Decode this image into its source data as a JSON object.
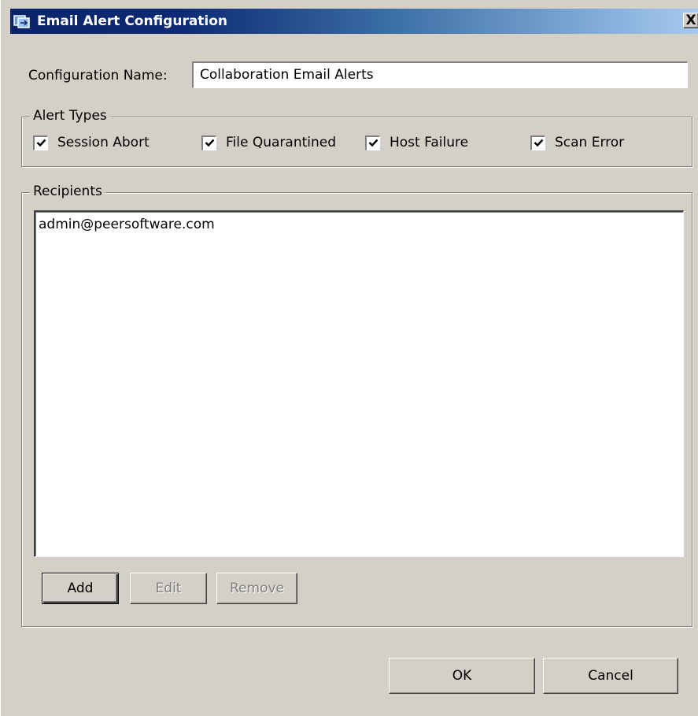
{
  "window": {
    "title": "Email Alert Configuration",
    "close_glyph": "X",
    "icon": "folder-sync-icon"
  },
  "config": {
    "name_label": "Configuration Name:",
    "name_value": "Collaboration Email Alerts"
  },
  "alert_types": {
    "legend": "Alert Types",
    "items": [
      {
        "label": "Session Abort",
        "checked": true
      },
      {
        "label": "File Quarantined",
        "checked": true
      },
      {
        "label": "Host Failure",
        "checked": true
      },
      {
        "label": "Scan Error",
        "checked": true
      }
    ]
  },
  "recipients": {
    "legend": "Recipients",
    "items": [
      "admin@peersoftware.com"
    ],
    "add_label": "Add",
    "edit_label": "Edit",
    "remove_label": "Remove"
  },
  "footer": {
    "ok_label": "OK",
    "cancel_label": "Cancel"
  },
  "colors": {
    "title_start": "#0a246a",
    "title_end": "#a6caf0",
    "face": "#d4d0c8"
  }
}
